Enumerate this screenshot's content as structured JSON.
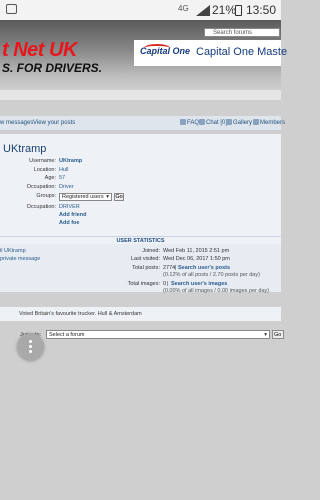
{
  "statusbar": {
    "signal": "4G",
    "battery": "21%",
    "time": "13:50"
  },
  "header": {
    "logo_main": "t Net UK",
    "logo_sub": "S. FOR DRIVERS.",
    "search_placeholder": "Search forums",
    "ad_logo": "Capital One",
    "ad_title": "Capital One Maste"
  },
  "nav": {
    "left_links": [
      "w messages",
      "View your posts"
    ],
    "right_links": [
      "FAQ",
      "Chat [0]",
      "Gallery",
      "Members"
    ]
  },
  "profile": {
    "title": "UKtramp",
    "fields": [
      {
        "label": "Username:",
        "value": "UKtramp"
      },
      {
        "label": "Location:",
        "value": "Hull"
      },
      {
        "label": "Age:",
        "value": "57"
      },
      {
        "label": "Occupation:",
        "value": "Driver"
      }
    ],
    "groups_label": "Groups:",
    "groups_selected": "Registered users",
    "go_label": "Go",
    "occupation2_label": "Occupation:",
    "occupation2_value": "DRIVER",
    "add_friend": "Add friend",
    "add_foe": "Add foe"
  },
  "stats": {
    "heading": "USER STATISTICS",
    "left_links": [
      "il UKtramp",
      "private message"
    ],
    "joined_label": "Joined:",
    "joined_value": "Wed Feb 11, 2015 2:51 pm",
    "last_visited_label": "Last visited:",
    "last_visited_value": "Wed Dec 06, 2017 1:50 pm",
    "total_posts_label": "Total posts:",
    "total_posts_value": "2774",
    "search_posts": "Search user's posts",
    "posts_detail": "(0.12% of all posts / 2.70 posts per day)",
    "total_images_label": "Total images:",
    "total_images_value": "0",
    "search_images": "Search user's images",
    "images_detail": "(0.00% of all images / 0.00 images per day)"
  },
  "signature": "Voted Britain's favourite trucker. Hull & Amsterdam",
  "jump": {
    "label": "Jump to:",
    "selected": "Select a forum",
    "go": "Go"
  }
}
